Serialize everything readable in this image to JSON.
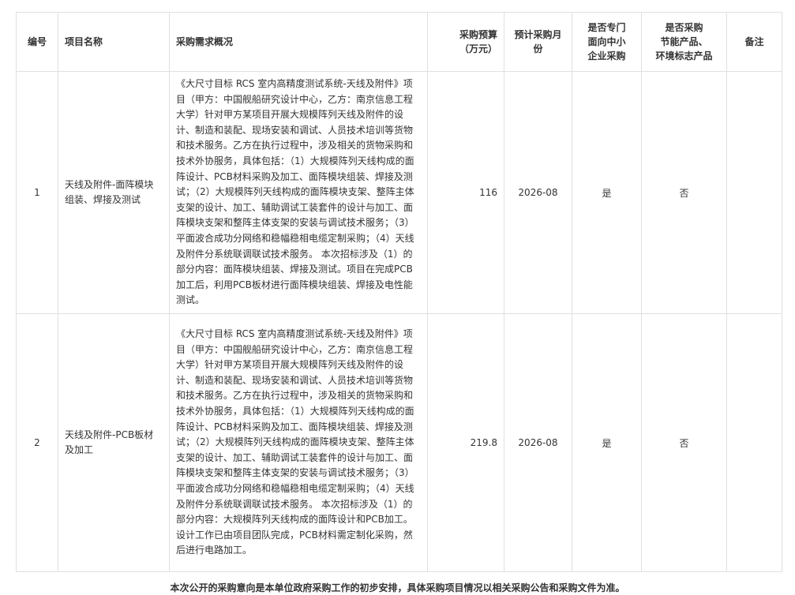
{
  "table": {
    "headers": {
      "no": "编号",
      "name": "项目名称",
      "desc": "采购需求概况",
      "budget_1": "采购预算",
      "budget_2": "（万元）",
      "month_1": "预计采购月",
      "month_2": "份",
      "sme_1": "是否专门",
      "sme_2": "面向中小",
      "sme_3": "企业采购",
      "eco_1": "是否采购",
      "eco_2": "节能产品、",
      "eco_3": "环境标志产品",
      "note": "备注"
    },
    "rows": [
      {
        "no": "1",
        "name": "天线及附件-面阵模块组装、焊接及测试",
        "desc": "《大尺寸目标 RCS 室内高精度测试系统-天线及附件》项目（甲方：中国舰船研究设计中心，乙方：南京信息工程大学）针对甲方某项目开展大规模阵列天线及附件的设计、制造和装配、现场安装和调试、人员技术培训等货物和技术服务。乙方在执行过程中，涉及相关的货物采购和技术外协服务，具体包括：（1）大规模阵列天线构成的面阵设计、PCB材料采购及加工、面阵模块组装、焊接及测试；（2）大规模阵列天线构成的面阵模块支架、整阵主体支架的设计、加工、辅助调试工装套件的设计与加工、面阵模块支架和整阵主体支架的安装与调试技术服务；（3）平面波合成功分网络和稳幅稳相电缆定制采购；（4）天线及附件分系统联调联试技术服务。 本次招标涉及（1）的部分内容：面阵模块组装、焊接及测试。项目在完成PCB加工后，利用PCB板材进行面阵模块组装、焊接及电性能测试。",
        "budget": "116",
        "month": "2026-08",
        "sme": "是",
        "eco": "否",
        "note": ""
      },
      {
        "no": "2",
        "name": "天线及附件-PCB板材及加工",
        "desc": "《大尺寸目标 RCS 室内高精度测试系统-天线及附件》项目（甲方：中国舰船研究设计中心，乙方：南京信息工程大学）针对甲方某项目开展大规模阵列天线及附件的设计、制造和装配、现场安装和调试、人员技术培训等货物和技术服务。乙方在执行过程中，涉及相关的货物采购和技术外协服务，具体包括：（1）大规模阵列天线构成的面阵设计、PCB材料采购及加工、面阵模块组装、焊接及测试；（2）大规模阵列天线构成的面阵模块支架、整阵主体支架的设计、加工、辅助调试工装套件的设计与加工、面阵模块支架和整阵主体支架的安装与调试技术服务；（3）平面波合成功分网络和稳幅稳相电缆定制采购；（4）天线及附件分系统联调联试技术服务。 本次招标涉及（1）的部分内容：大规模阵列天线构成的面阵设计和PCB加工。设计工作已由项目团队完成，PCB材料需定制化采购，然后进行电路加工。",
        "budget": "219.8",
        "month": "2026-08",
        "sme": "是",
        "eco": "否",
        "note": ""
      }
    ]
  },
  "footer_note": "本次公开的采购意向是本单位政府采购工作的初步安排，具体采购项目情况以相关采购公告和采购文件为准。"
}
